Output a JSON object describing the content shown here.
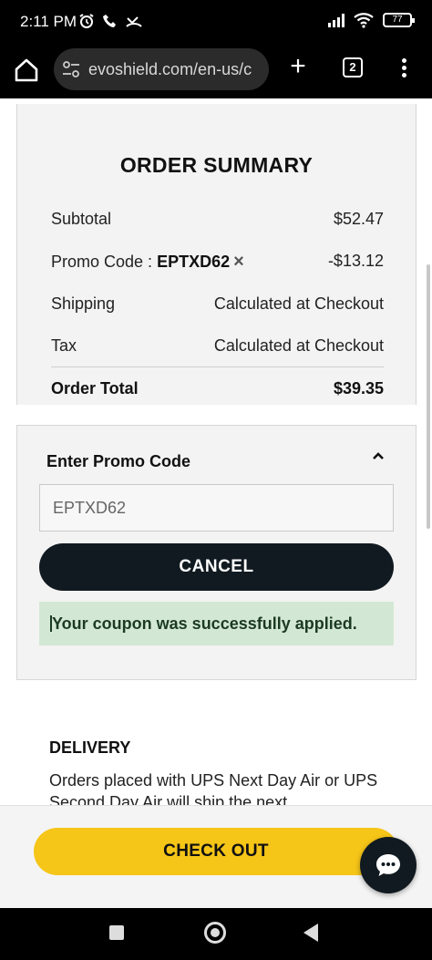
{
  "status_bar": {
    "time": "2:11 PM",
    "battery": "77"
  },
  "browser": {
    "url": "evoshield.com/en-us/c",
    "tab_count": "2"
  },
  "order_summary": {
    "title": "ORDER SUMMARY",
    "subtotal_label": "Subtotal",
    "subtotal_value": "$52.47",
    "promo_label": "Promo Code : ",
    "promo_code": "EPTXD62",
    "promo_value": "-$13.12",
    "shipping_label": "Shipping",
    "shipping_value": "Calculated at Checkout",
    "tax_label": "Tax",
    "tax_value": "Calculated at Checkout",
    "total_label": "Order Total",
    "total_value": "$39.35"
  },
  "promo_section": {
    "heading": "Enter Promo Code",
    "input_value": "EPTXD62",
    "cancel_label": "CANCEL",
    "success_message": "Your coupon was successfully applied."
  },
  "delivery": {
    "title": "DELIVERY",
    "text": "Orders placed with UPS Next Day Air or UPS Second Day Air will ship the next"
  },
  "checkout": {
    "label": "CHECK OUT"
  },
  "colors": {
    "checkout_yellow": "#f5c518",
    "dark_button": "#111a21",
    "success_bg": "#d3e8d4"
  }
}
